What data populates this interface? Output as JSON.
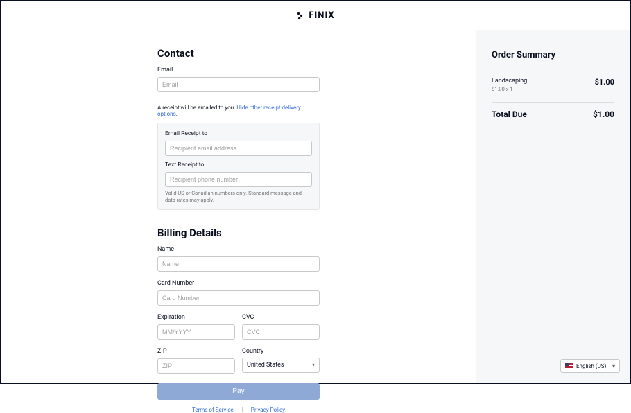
{
  "brand": "FINIX",
  "contact": {
    "title": "Contact",
    "email_label": "Email",
    "email_placeholder": "Email",
    "receipt_note_prefix": "A receipt will be emailed to you. ",
    "receipt_note_link": "Hide other receipt delivery options",
    "email_receipt_label": "Email Receipt to",
    "email_receipt_placeholder": "Recipient email address",
    "text_receipt_label": "Text Receipt to",
    "text_receipt_placeholder": "Recipient phone number",
    "text_receipt_help": "Valid US or Canadian numbers only. Standard message and data rates may apply."
  },
  "billing": {
    "title": "Billing Details",
    "name_label": "Name",
    "name_placeholder": "Name",
    "card_label": "Card Number",
    "card_placeholder": "Card Number",
    "exp_label": "Expiration",
    "exp_placeholder": "MM/YYYY",
    "cvc_label": "CVC",
    "cvc_placeholder": "CVC",
    "zip_label": "ZIP",
    "zip_placeholder": "ZIP",
    "country_label": "Country",
    "country_value": "United States"
  },
  "pay_label": "Pay",
  "footer": {
    "tos": "Terms of Service",
    "privacy": "Privacy Policy"
  },
  "summary": {
    "title": "Order Summary",
    "item_name": "Landscaping",
    "item_sub": "$1.00 x 1",
    "item_amount": "$1.00",
    "total_label": "Total Due",
    "total_amount": "$1.00"
  },
  "language": {
    "label": "English (US)"
  }
}
